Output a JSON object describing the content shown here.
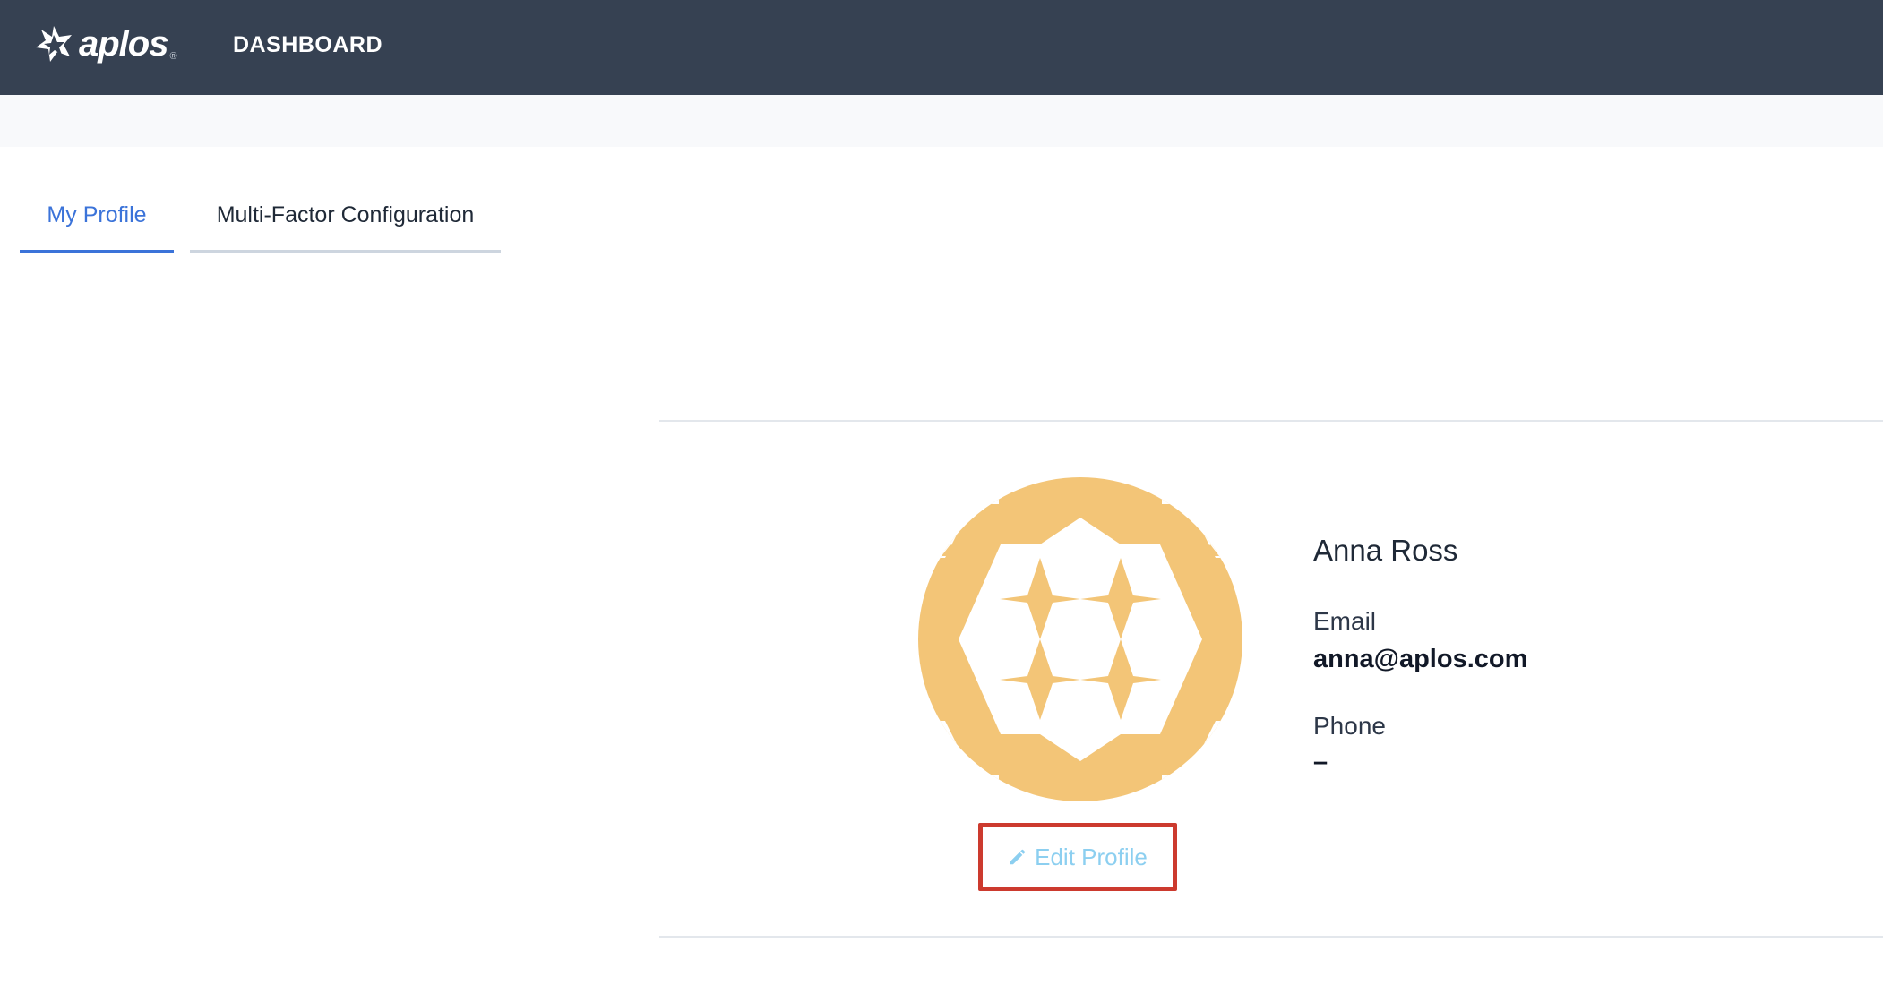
{
  "app": {
    "logo_text": "aplos",
    "logo_reg": "®"
  },
  "nav": {
    "dashboard": "DASHBOARD"
  },
  "tabs": [
    {
      "label": "My Profile",
      "active": true
    },
    {
      "label": "Multi-Factor Configuration",
      "active": false
    }
  ],
  "profile": {
    "name": "Anna Ross",
    "email_label": "Email",
    "email_value": "anna@aplos.com",
    "phone_label": "Phone",
    "phone_value": "–",
    "edit_button": "Edit Profile"
  },
  "colors": {
    "header_bg": "#364152",
    "accent": "#3b73d9",
    "avatar": "#f3c577",
    "edit_link": "#8ccff0",
    "highlight_box": "#cc3a2e"
  },
  "icons": {
    "logo": "aplos-logo-icon",
    "edit": "pencil-icon",
    "avatar": "identicon-avatar"
  }
}
